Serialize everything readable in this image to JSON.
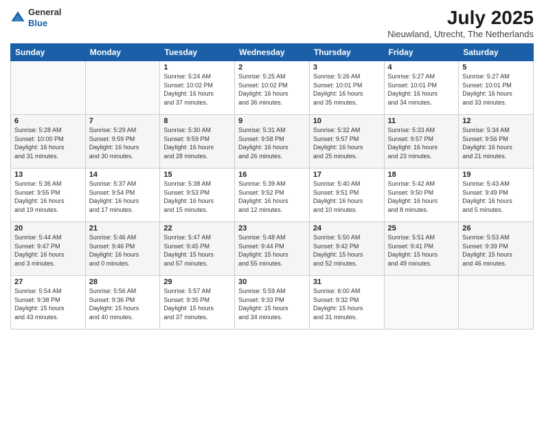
{
  "header": {
    "logo_line1": "General",
    "logo_line2": "Blue",
    "month": "July 2025",
    "location": "Nieuwland, Utrecht, The Netherlands"
  },
  "weekdays": [
    "Sunday",
    "Monday",
    "Tuesday",
    "Wednesday",
    "Thursday",
    "Friday",
    "Saturday"
  ],
  "weeks": [
    [
      {
        "day": "",
        "info": ""
      },
      {
        "day": "",
        "info": ""
      },
      {
        "day": "1",
        "info": "Sunrise: 5:24 AM\nSunset: 10:02 PM\nDaylight: 16 hours\nand 37 minutes."
      },
      {
        "day": "2",
        "info": "Sunrise: 5:25 AM\nSunset: 10:02 PM\nDaylight: 16 hours\nand 36 minutes."
      },
      {
        "day": "3",
        "info": "Sunrise: 5:26 AM\nSunset: 10:01 PM\nDaylight: 16 hours\nand 35 minutes."
      },
      {
        "day": "4",
        "info": "Sunrise: 5:27 AM\nSunset: 10:01 PM\nDaylight: 16 hours\nand 34 minutes."
      },
      {
        "day": "5",
        "info": "Sunrise: 5:27 AM\nSunset: 10:01 PM\nDaylight: 16 hours\nand 33 minutes."
      }
    ],
    [
      {
        "day": "6",
        "info": "Sunrise: 5:28 AM\nSunset: 10:00 PM\nDaylight: 16 hours\nand 31 minutes."
      },
      {
        "day": "7",
        "info": "Sunrise: 5:29 AM\nSunset: 9:59 PM\nDaylight: 16 hours\nand 30 minutes."
      },
      {
        "day": "8",
        "info": "Sunrise: 5:30 AM\nSunset: 9:59 PM\nDaylight: 16 hours\nand 28 minutes."
      },
      {
        "day": "9",
        "info": "Sunrise: 5:31 AM\nSunset: 9:58 PM\nDaylight: 16 hours\nand 26 minutes."
      },
      {
        "day": "10",
        "info": "Sunrise: 5:32 AM\nSunset: 9:57 PM\nDaylight: 16 hours\nand 25 minutes."
      },
      {
        "day": "11",
        "info": "Sunrise: 5:33 AM\nSunset: 9:57 PM\nDaylight: 16 hours\nand 23 minutes."
      },
      {
        "day": "12",
        "info": "Sunrise: 5:34 AM\nSunset: 9:56 PM\nDaylight: 16 hours\nand 21 minutes."
      }
    ],
    [
      {
        "day": "13",
        "info": "Sunrise: 5:36 AM\nSunset: 9:55 PM\nDaylight: 16 hours\nand 19 minutes."
      },
      {
        "day": "14",
        "info": "Sunrise: 5:37 AM\nSunset: 9:54 PM\nDaylight: 16 hours\nand 17 minutes."
      },
      {
        "day": "15",
        "info": "Sunrise: 5:38 AM\nSunset: 9:53 PM\nDaylight: 16 hours\nand 15 minutes."
      },
      {
        "day": "16",
        "info": "Sunrise: 5:39 AM\nSunset: 9:52 PM\nDaylight: 16 hours\nand 12 minutes."
      },
      {
        "day": "17",
        "info": "Sunrise: 5:40 AM\nSunset: 9:51 PM\nDaylight: 16 hours\nand 10 minutes."
      },
      {
        "day": "18",
        "info": "Sunrise: 5:42 AM\nSunset: 9:50 PM\nDaylight: 16 hours\nand 8 minutes."
      },
      {
        "day": "19",
        "info": "Sunrise: 5:43 AM\nSunset: 9:49 PM\nDaylight: 16 hours\nand 5 minutes."
      }
    ],
    [
      {
        "day": "20",
        "info": "Sunrise: 5:44 AM\nSunset: 9:47 PM\nDaylight: 16 hours\nand 3 minutes."
      },
      {
        "day": "21",
        "info": "Sunrise: 5:46 AM\nSunset: 9:46 PM\nDaylight: 16 hours\nand 0 minutes."
      },
      {
        "day": "22",
        "info": "Sunrise: 5:47 AM\nSunset: 9:45 PM\nDaylight: 15 hours\nand 57 minutes."
      },
      {
        "day": "23",
        "info": "Sunrise: 5:48 AM\nSunset: 9:44 PM\nDaylight: 15 hours\nand 55 minutes."
      },
      {
        "day": "24",
        "info": "Sunrise: 5:50 AM\nSunset: 9:42 PM\nDaylight: 15 hours\nand 52 minutes."
      },
      {
        "day": "25",
        "info": "Sunrise: 5:51 AM\nSunset: 9:41 PM\nDaylight: 15 hours\nand 49 minutes."
      },
      {
        "day": "26",
        "info": "Sunrise: 5:53 AM\nSunset: 9:39 PM\nDaylight: 15 hours\nand 46 minutes."
      }
    ],
    [
      {
        "day": "27",
        "info": "Sunrise: 5:54 AM\nSunset: 9:38 PM\nDaylight: 15 hours\nand 43 minutes."
      },
      {
        "day": "28",
        "info": "Sunrise: 5:56 AM\nSunset: 9:36 PM\nDaylight: 15 hours\nand 40 minutes."
      },
      {
        "day": "29",
        "info": "Sunrise: 5:57 AM\nSunset: 9:35 PM\nDaylight: 15 hours\nand 37 minutes."
      },
      {
        "day": "30",
        "info": "Sunrise: 5:59 AM\nSunset: 9:33 PM\nDaylight: 15 hours\nand 34 minutes."
      },
      {
        "day": "31",
        "info": "Sunrise: 6:00 AM\nSunset: 9:32 PM\nDaylight: 15 hours\nand 31 minutes."
      },
      {
        "day": "",
        "info": ""
      },
      {
        "day": "",
        "info": ""
      }
    ]
  ]
}
